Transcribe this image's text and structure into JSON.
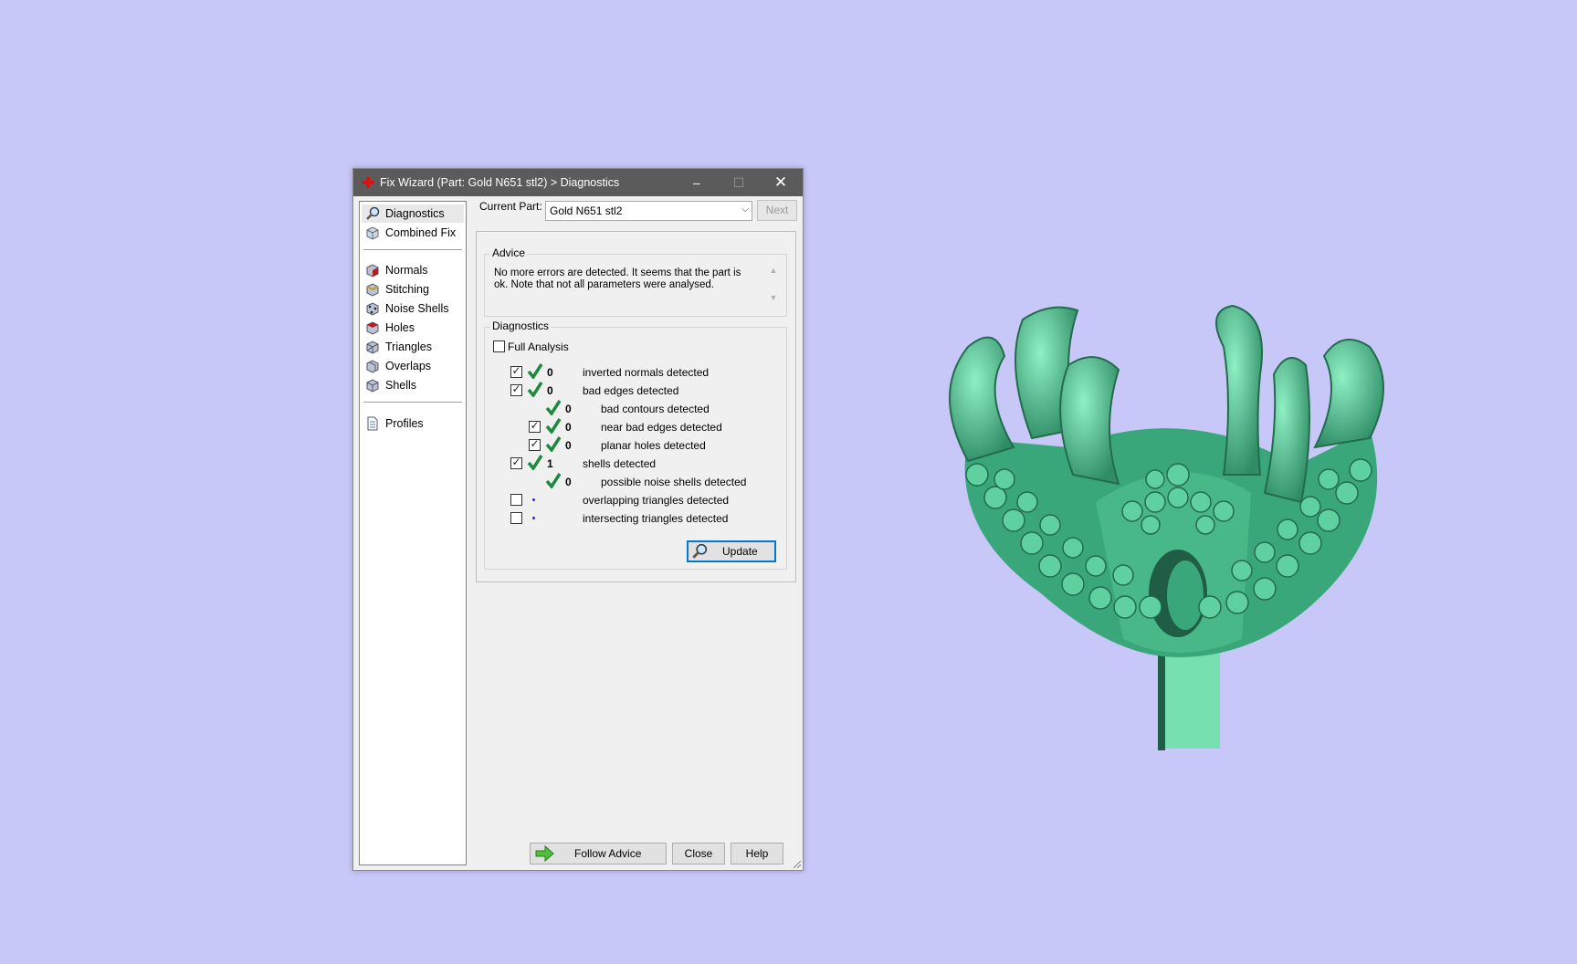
{
  "window": {
    "title": "Fix Wizard (Part: Gold N651 stl2) > Diagnostics",
    "minimize": "–",
    "maximize": "☐",
    "close": "✕"
  },
  "sidebar": {
    "items": [
      {
        "label": "Diagnostics",
        "icon": "magnifier-icon",
        "selected": true
      },
      {
        "label": "Combined Fix",
        "icon": "cube-icon"
      },
      {
        "label": "Normals",
        "icon": "normals-cube-icon"
      },
      {
        "label": "Stitching",
        "icon": "stitching-cube-icon"
      },
      {
        "label": "Noise Shells",
        "icon": "noise-shells-icon"
      },
      {
        "label": "Holes",
        "icon": "holes-cube-icon"
      },
      {
        "label": "Triangles",
        "icon": "triangles-cube-icon"
      },
      {
        "label": "Overlaps",
        "icon": "overlaps-cube-icon"
      },
      {
        "label": "Shells",
        "icon": "shells-cube-icon"
      },
      {
        "label": "Profiles",
        "icon": "document-icon"
      }
    ]
  },
  "current_part": {
    "label": "Current Part:",
    "value": "Gold N651 stl2",
    "next_label": "Next"
  },
  "advice": {
    "title": "Advice",
    "text": "No more errors are detected. It seems that the part is ok. Note that not all parameters were analysed."
  },
  "diagnostics": {
    "title": "Diagnostics",
    "full_analysis_label": "Full Analysis",
    "full_analysis_checked": false,
    "rows": [
      {
        "label": "inverted normals detected",
        "count": "0",
        "checked": true,
        "status": "ok",
        "indent": 0
      },
      {
        "label": "bad edges detected",
        "count": "0",
        "checked": true,
        "status": "ok",
        "indent": 0
      },
      {
        "label": "bad contours detected",
        "count": "0",
        "checked": null,
        "status": "ok",
        "indent": 1
      },
      {
        "label": "near bad edges detected",
        "count": "0",
        "checked": true,
        "status": "ok",
        "indent": 1
      },
      {
        "label": "planar holes detected",
        "count": "0",
        "checked": true,
        "status": "ok",
        "indent": 1
      },
      {
        "label": "shells detected",
        "count": "1",
        "checked": true,
        "status": "ok",
        "indent": 0
      },
      {
        "label": "possible noise shells detected",
        "count": "0",
        "checked": null,
        "status": "ok",
        "indent": 1
      },
      {
        "label": "overlapping triangles detected",
        "count": "",
        "checked": false,
        "status": "not-analysed",
        "indent": 0
      },
      {
        "label": "intersecting triangles detected",
        "count": "",
        "checked": false,
        "status": "not-analysed",
        "indent": 0
      }
    ],
    "update_label": "Update"
  },
  "footer": {
    "follow_advice_label": "Follow Advice",
    "close_label": "Close",
    "help_label": "Help"
  },
  "colors": {
    "background": "#c8c8f8",
    "model": "#4fc496",
    "titlebar": "#5b5b5b",
    "check_green": "#1e8a3e"
  }
}
